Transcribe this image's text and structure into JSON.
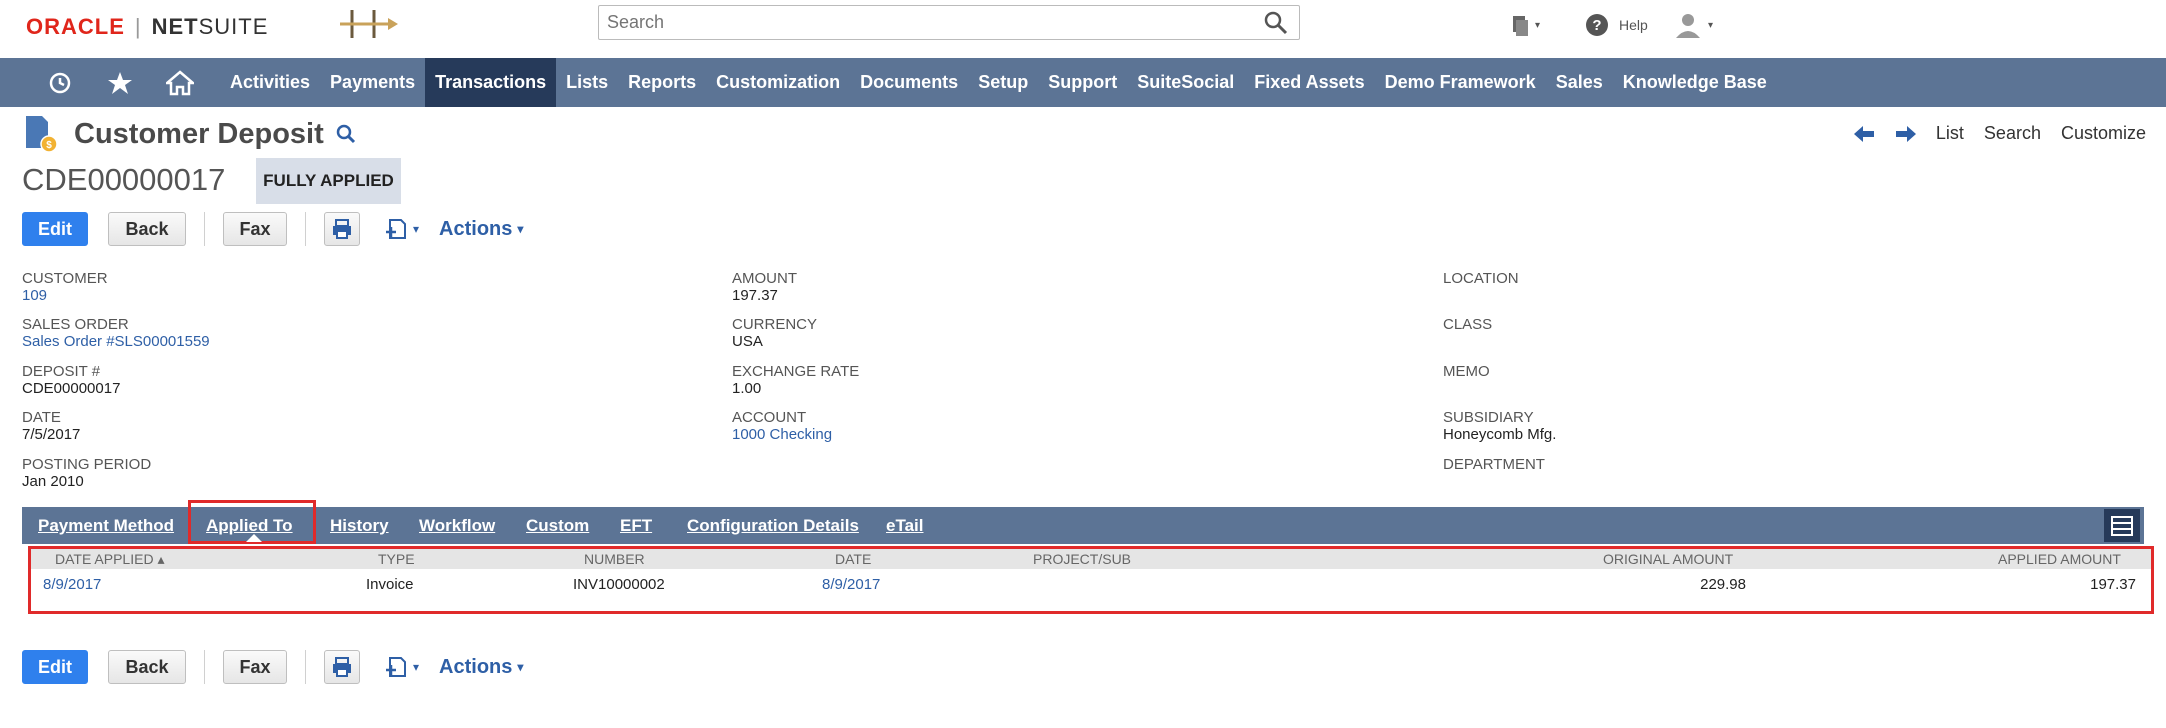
{
  "brand": {
    "oracle": "ORACLE",
    "netsuite_bold": "NET",
    "netsuite_rest": "SUITE"
  },
  "search": {
    "placeholder": "Search"
  },
  "header_icons": {
    "help_label": "Help"
  },
  "nav": {
    "items": [
      "Activities",
      "Payments",
      "Transactions",
      "Lists",
      "Reports",
      "Customization",
      "Documents",
      "Setup",
      "Support",
      "SuiteSocial",
      "Fixed Assets",
      "Demo Framework",
      "Sales",
      "Knowledge Base"
    ],
    "active": "Transactions"
  },
  "page": {
    "title": "Customer Deposit",
    "record_id": "CDE00000017",
    "status": "FULLY APPLIED"
  },
  "right_links": {
    "list": "List",
    "search": "Search",
    "customize": "Customize"
  },
  "buttons": {
    "edit": "Edit",
    "back": "Back",
    "fax": "Fax",
    "actions": "Actions"
  },
  "fields": {
    "col1": [
      {
        "label": "CUSTOMER",
        "value": "109",
        "link": true
      },
      {
        "label": "SALES ORDER",
        "value": "Sales Order #SLS00001559",
        "link": true
      },
      {
        "label": "DEPOSIT #",
        "value": "CDE00000017",
        "link": false
      },
      {
        "label": "DATE",
        "value": "7/5/2017",
        "link": false
      },
      {
        "label": "POSTING PERIOD",
        "value": "Jan 2010",
        "link": false
      }
    ],
    "col2": [
      {
        "label": "AMOUNT",
        "value": "197.37",
        "link": false
      },
      {
        "label": "CURRENCY",
        "value": "USA",
        "link": false
      },
      {
        "label": "EXCHANGE RATE",
        "value": "1.00",
        "link": false
      },
      {
        "label": "ACCOUNT",
        "value": "1000 Checking",
        "link": true
      }
    ],
    "col3": [
      {
        "label": "LOCATION",
        "value": "",
        "link": false
      },
      {
        "label": "CLASS",
        "value": "",
        "link": false
      },
      {
        "label": "MEMO",
        "value": "",
        "link": false
      },
      {
        "label": "SUBSIDIARY",
        "value": "Honeycomb Mfg.",
        "link": false
      },
      {
        "label": "DEPARTMENT",
        "value": "",
        "link": false
      }
    ]
  },
  "tabs": [
    "Payment Method",
    "Applied To",
    "History",
    "Workflow",
    "Custom",
    "EFT",
    "Configuration Details",
    "eTail"
  ],
  "active_tab": "Applied To",
  "table": {
    "headers": [
      "DATE APPLIED ▴",
      "TYPE",
      "NUMBER",
      "DATE",
      "PROJECT/SUB",
      "ORIGINAL AMOUNT",
      "APPLIED AMOUNT"
    ],
    "rows": [
      [
        "8/9/2017",
        "Invoice",
        "INV10000002",
        "8/9/2017",
        "",
        "229.98",
        "197.37"
      ]
    ]
  },
  "colors": {
    "nav_bg": "#5c7495",
    "nav_active": "#263a5a",
    "primary_button": "#2f80ed",
    "link": "#2e5fa6",
    "highlight": "#e02a2a"
  }
}
